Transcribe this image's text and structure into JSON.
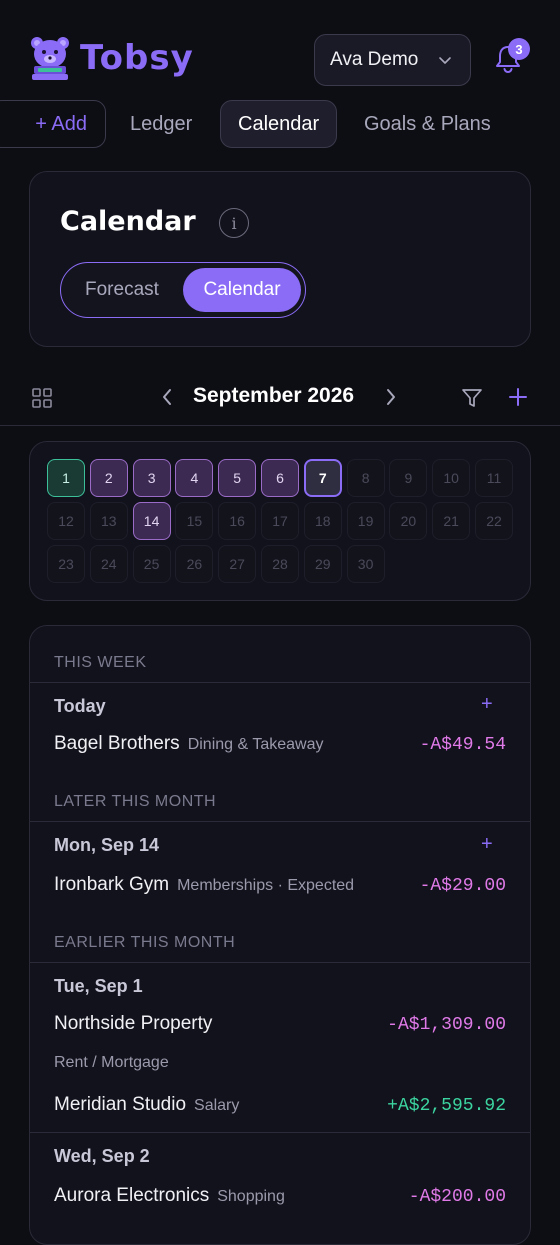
{
  "app": {
    "brand": "Tobsy"
  },
  "header": {
    "user": "Ava Demo",
    "notifications": "3"
  },
  "nav": {
    "add": "+ Add",
    "items": [
      "Ledger",
      "Calendar",
      "Goals & Plans"
    ],
    "active": "Calendar"
  },
  "page": {
    "title": "Calendar",
    "info_glyph": "i",
    "view_toggle": {
      "forecast": "Forecast",
      "calendar": "Calendar",
      "active": "Calendar"
    }
  },
  "month": {
    "label": "September 2026",
    "prev": "‹",
    "next": "›"
  },
  "calendar": {
    "days": [
      "1",
      "2",
      "3",
      "4",
      "5",
      "6",
      "7",
      "8",
      "9",
      "10",
      "11",
      "12",
      "13",
      "14",
      "15",
      "16",
      "17",
      "18",
      "19",
      "20",
      "21",
      "22",
      "23",
      "24",
      "25",
      "26",
      "27",
      "28",
      "29",
      "30"
    ],
    "today": "1",
    "selected": "7",
    "with_transactions": [
      "2",
      "3",
      "4",
      "5",
      "6",
      "14"
    ]
  },
  "transactions": {
    "this_week": {
      "label": "THIS WEEK",
      "groups": [
        {
          "date": "Today",
          "add": "+",
          "items": [
            {
              "name": "Bagel Brothers",
              "category": "Dining & Takeaway",
              "amount": "-A$49.54"
            }
          ]
        }
      ]
    },
    "later_this_month": {
      "label": "LATER THIS MONTH",
      "groups": [
        {
          "date": "Mon, Sep 14",
          "add": "+",
          "items": [
            {
              "name": "Ironbark Gym",
              "category": "Memberships · Expected",
              "amount": "-A$29.00"
            }
          ]
        }
      ]
    },
    "earlier_this_month": {
      "label": "EARLIER THIS MONTH",
      "groups": [
        {
          "date": "Tue, Sep 1",
          "items": [
            {
              "name": "Northside Property",
              "category": "Rent / Mortgage",
              "amount": "-A$1,309.00"
            },
            {
              "name": "Meridian Studio",
              "category": "Salary",
              "amount": "+A$2,595.92"
            }
          ]
        },
        {
          "date": "Wed, Sep 2",
          "items": [
            {
              "name": "Aurora Electronics",
              "category": "Shopping",
              "amount": "-A$200.00"
            }
          ]
        }
      ]
    }
  },
  "colors": {
    "accent": "#8b6cf6",
    "background": "#0d0d14",
    "negative": "#e07ae8",
    "positive": "#3cd4a0",
    "today": "#3cc09a"
  }
}
